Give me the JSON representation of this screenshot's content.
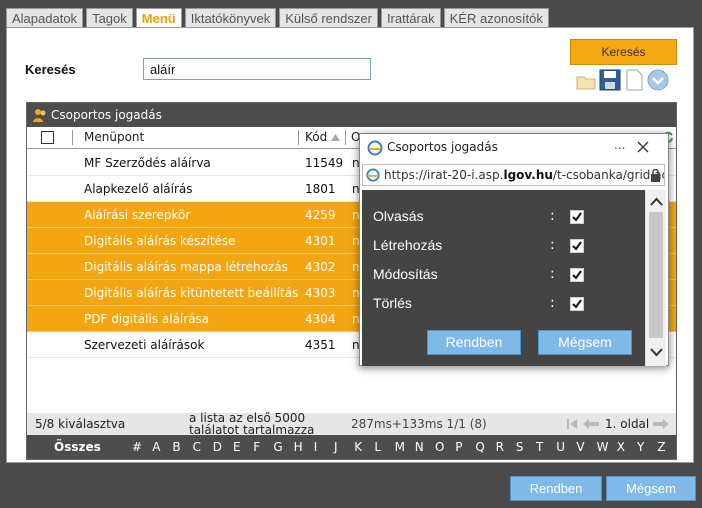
{
  "tabs": [
    "Alapadatok",
    "Tagok",
    "Menü",
    "Iktatókönyvek",
    "Külső rendszer",
    "Irattárak",
    "KÉR azonosítók"
  ],
  "search": {
    "label": "Keresés",
    "value": "aláír",
    "button": "Keresés"
  },
  "grid": {
    "title": "Csoportos jogadás",
    "columns": {
      "menupont": "Menüpont",
      "kod": "Kód",
      "other": "O"
    },
    "rows": [
      {
        "name": "MF Szerződés aláírva",
        "code": "11549",
        "extra": "n",
        "selected": false
      },
      {
        "name": "Alapkezelő aláírás",
        "code": "1801",
        "extra": "n",
        "selected": false
      },
      {
        "name": "Aláírási szerepkör",
        "code": "4259",
        "extra": "n",
        "selected": true
      },
      {
        "name": "Digitális aláírás készítése",
        "code": "4301",
        "extra": "n",
        "selected": true
      },
      {
        "name": "Digitális aláírás mappa létrehozás",
        "code": "4302",
        "extra": "n",
        "selected": true
      },
      {
        "name": "Digitális aláírás kitüntetett beállítás",
        "code": "4303",
        "extra": "n",
        "selected": true
      },
      {
        "name": "PDF digitális aláírása",
        "code": "4304",
        "extra": "n",
        "selected": true
      },
      {
        "name": "Szervezeti aláírások",
        "code": "4351",
        "extra": "n",
        "selected": false
      }
    ],
    "footer": {
      "selected": "5/8 kiválasztva",
      "note": "a lista az első 5000 találatot tartalmazza",
      "timing": "287ms+133ms 1/1 (8)",
      "page": "1. oldal"
    },
    "alphabet": {
      "all": "Összes",
      "letters": [
        "#",
        "A",
        "B",
        "C",
        "D",
        "E",
        "F",
        "G",
        "H",
        "I",
        "J",
        "K",
        "L",
        "M",
        "N",
        "O",
        "P",
        "Q",
        "R",
        "S",
        "T",
        "U",
        "V",
        "W",
        "X",
        "Y",
        "Z"
      ]
    }
  },
  "popup": {
    "title": "Csoportos jogadás",
    "menu_dots": "...",
    "url_prefix": "https://irat-20-i.asp.",
    "url_bold": "lgov.hu",
    "url_suffix": "/t-csobanka/grid.ac",
    "permissions": [
      {
        "label": "Olvasás",
        "checked": true
      },
      {
        "label": "Létrehozás",
        "checked": true
      },
      {
        "label": "Módosítás",
        "checked": true
      },
      {
        "label": "Törlés",
        "checked": true
      }
    ],
    "ok": "Rendben",
    "cancel": "Mégsem"
  },
  "bottom": {
    "ok": "Rendben",
    "cancel": "Mégsem"
  },
  "colors": {
    "accent": "#f3a612",
    "button": "#7fb9e8",
    "dark": "#4d4d4d"
  }
}
